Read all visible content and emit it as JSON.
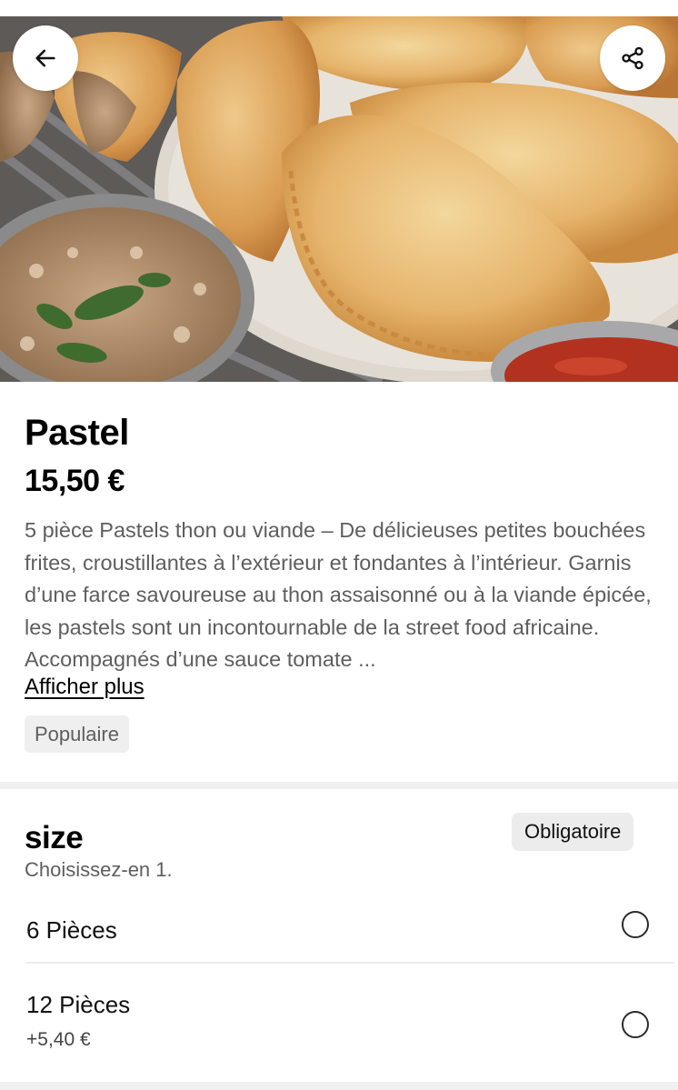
{
  "product": {
    "title": "Pastel",
    "price": "15,50 €",
    "description": "5 pièce Pastels thon ou viande – De délicieuses petites bouchées frites, croustillantes à l’extérieur et fondantes à l’intérieur. Garnis d’une farce savoureuse au thon assaisonné ou à la viande épicée, les pastels sont un incontournable de la street food africaine. Accompagnés d’une sauce tomate ...",
    "show_more": "Afficher plus",
    "badge": "Populaire"
  },
  "actions": {
    "back_icon": "arrow-left-icon",
    "share_icon": "share-icon"
  },
  "options_group": {
    "title": "size",
    "hint": "Choisissez-en 1.",
    "required_badge": "Obligatoire",
    "options": [
      {
        "label": "6 Pièces",
        "extra": "",
        "selected": false
      },
      {
        "label": "12 Pièces",
        "extra": "+5,40 €",
        "selected": false
      }
    ]
  }
}
